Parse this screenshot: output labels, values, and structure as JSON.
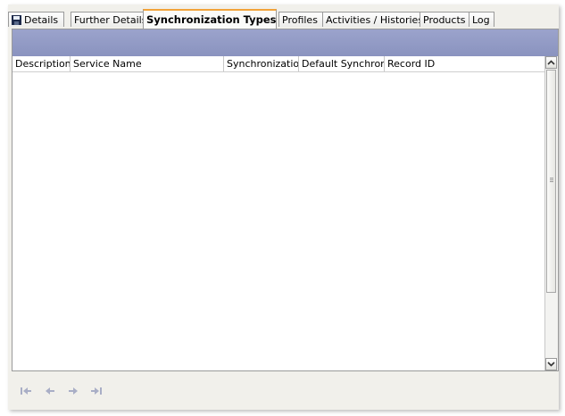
{
  "tabs": [
    {
      "label": "Details",
      "icon": "save-icon"
    },
    {
      "label": "Further Details"
    },
    {
      "label": "Synchronization Types",
      "active": true
    },
    {
      "label": "Profiles"
    },
    {
      "label": "Activities / Histories"
    },
    {
      "label": "Products"
    },
    {
      "label": "Log"
    }
  ],
  "grid": {
    "columns": [
      "Description",
      "Service Name",
      "Synchronization",
      "Default Synchroniz",
      "Record ID"
    ]
  },
  "scrollbar": {
    "up_icon": "chevron-up-icon",
    "down_icon": "chevron-down-icon"
  },
  "nav": {
    "first_icon": "first-record-icon",
    "prev_icon": "previous-record-icon",
    "next_icon": "next-record-icon",
    "last_icon": "last-record-icon"
  },
  "colors": {
    "toolbar_band": "#9ba3cc",
    "active_tab_accent": "#f2a33a",
    "nav_arrows": "#a9aec6"
  }
}
